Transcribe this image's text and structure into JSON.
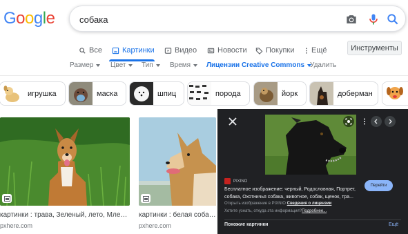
{
  "logo": {
    "letters": [
      "G",
      "o",
      "o",
      "g",
      "l",
      "e"
    ],
    "colors": [
      "#4285f4",
      "#ea4335",
      "#fbbc05",
      "#4285f4",
      "#34a853",
      "#ea4335"
    ]
  },
  "search": {
    "query": "собака",
    "icons": [
      "camera-icon",
      "mic-icon",
      "search-icon"
    ]
  },
  "tabs": [
    {
      "label": "Все",
      "icon": "search-icon",
      "active": false
    },
    {
      "label": "Картинки",
      "icon": "image-icon",
      "active": true
    },
    {
      "label": "Видео",
      "icon": "video-icon",
      "active": false
    },
    {
      "label": "Новости",
      "icon": "news-icon",
      "active": false
    },
    {
      "label": "Покупки",
      "icon": "tag-icon",
      "active": false
    },
    {
      "label": "Ещё",
      "icon": "more-vert-icon",
      "active": false
    }
  ],
  "tools_label": "Инструменты",
  "filters": [
    {
      "label": "Размер",
      "dropdown": true
    },
    {
      "label": "Цвет",
      "dropdown": true
    },
    {
      "label": "Тип",
      "dropdown": true
    },
    {
      "label": "Время",
      "dropdown": true
    },
    {
      "label": "Лицензии Creative Commons",
      "dropdown": true
    },
    {
      "label": "Удалить",
      "dropdown": false
    }
  ],
  "chips": [
    {
      "label": "игрушка"
    },
    {
      "label": "маска"
    },
    {
      "label": "шпиц"
    },
    {
      "label": "порода"
    },
    {
      "label": "йорк"
    },
    {
      "label": "доберман"
    }
  ],
  "results": [
    {
      "caption": "картинки : трава, Зеленый, лето, Млекопи...",
      "domain": "pxhere.com"
    },
    {
      "caption": "картинки : белая собака, по",
      "domain": "pxhere.com"
    }
  ],
  "panel": {
    "source": "PIXINO",
    "description": "Бесплатное изображение: черный, Родословная, Портрет, собака, Охотничья собака, животное, собак, щенок, тра...",
    "meta_prefix": "Открыть изображение в",
    "meta_source": "PIXNIO",
    "meta_link": "Сведения о лицензии",
    "question_prefix": "Хотите узнать, откуда эта информация?",
    "question_link": "Подробнее...",
    "visit_label": "Перейти",
    "related_label": "Похожие картинки",
    "more_label": "Ещё"
  },
  "colors": {
    "accent": "#1a73e8",
    "panel_bg": "#202124",
    "visit_btn": "#8ab4f8"
  }
}
